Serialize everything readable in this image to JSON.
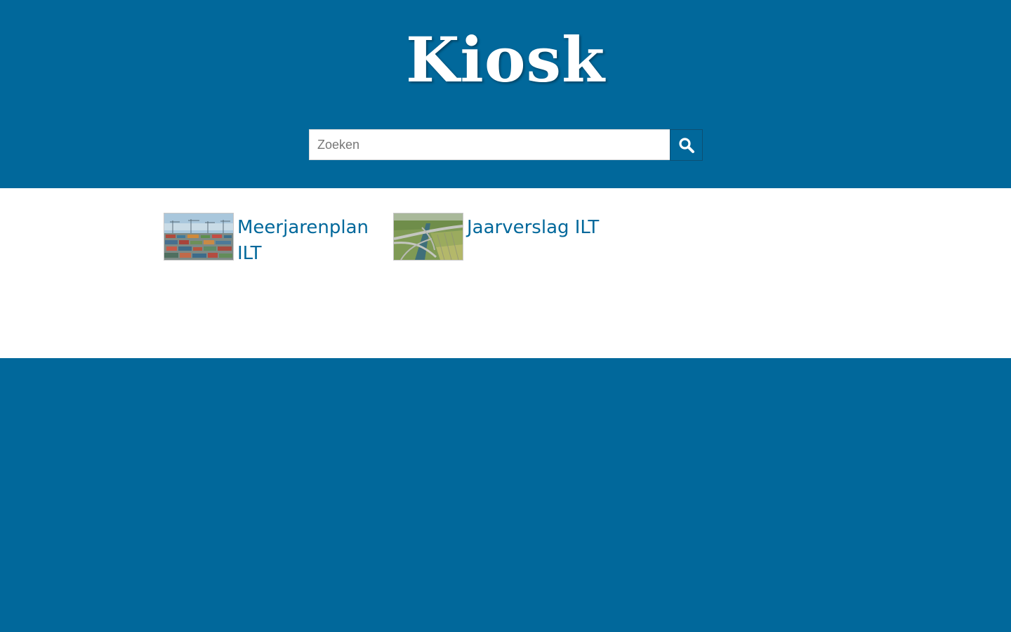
{
  "header": {
    "title": "Kiosk",
    "background_color": "#01689b"
  },
  "search": {
    "placeholder": "Zoeken",
    "value": "",
    "button_icon": "search-icon"
  },
  "publications": [
    {
      "title": "Meerjarenplan ILT",
      "thumbnail": "harbor-containers-image"
    },
    {
      "title": "Jaarverslag ILT",
      "thumbnail": "highway-aerial-image"
    }
  ],
  "colors": {
    "accent": "#01689b",
    "content_background": "#ffffff",
    "link_text": "#01689b"
  }
}
